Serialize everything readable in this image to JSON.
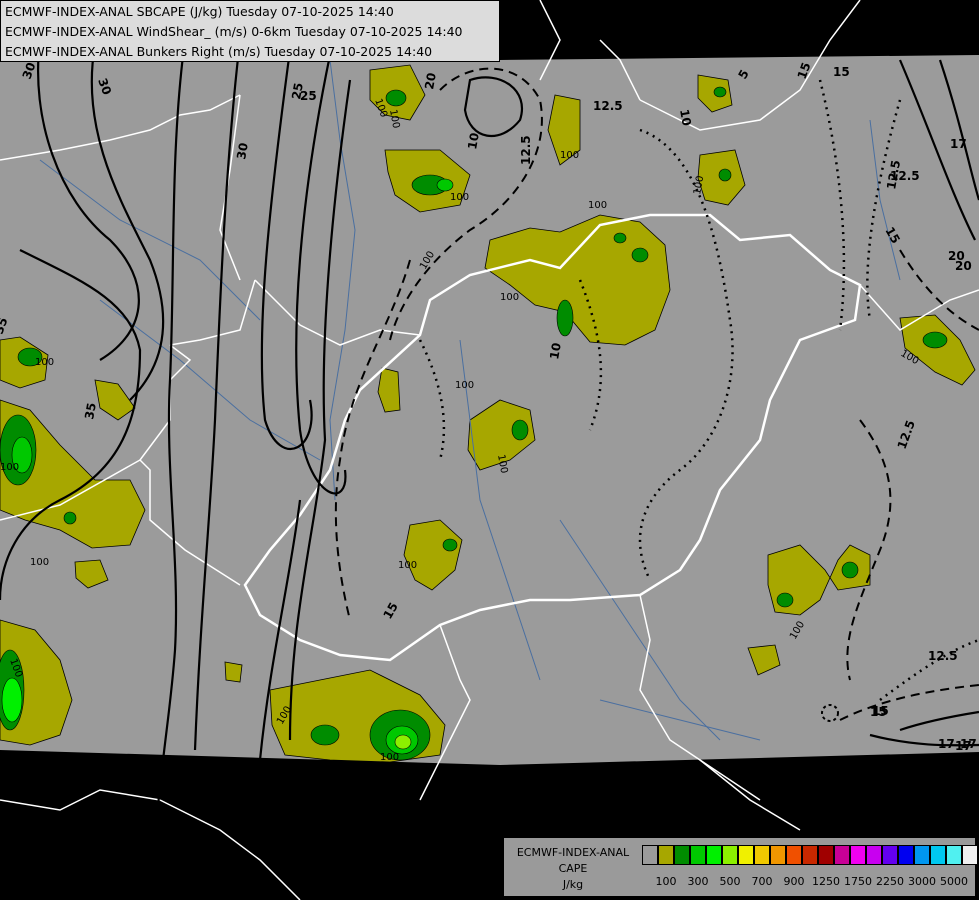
{
  "header": {
    "line1": "ECMWF-INDEX-ANAL SBCAPE (J/kg) Tuesday 07-10-2025 14:40",
    "line2": "ECMWF-INDEX-ANAL WindShear_ (m/s) 0-6km Tuesday 07-10-2025 14:40",
    "line3": "ECMWF-INDEX-ANAL Bunkers Right (m/s) Tuesday 07-10-2025 14:40"
  },
  "legend": {
    "name_line1": "ECMWF-INDEX-ANAL",
    "name_line2": "CAPE",
    "unit": "J/kg",
    "colors": [
      "#9b9b9b",
      "#a7a700",
      "#008c00",
      "#00c800",
      "#00f000",
      "#8cf000",
      "#f0f000",
      "#f0c800",
      "#f09600",
      "#f05000",
      "#c82800",
      "#a00000",
      "#c80096",
      "#f000f0",
      "#c800f0",
      "#6400f0",
      "#0000f0",
      "#0096f0",
      "#00c8f0",
      "#50f0f0",
      "#f0f0f0"
    ],
    "ticks": [
      "100",
      "300",
      "500",
      "700",
      "900",
      "1250",
      "1750",
      "2250",
      "3000",
      "5000"
    ]
  },
  "map": {
    "background_color": "#000000",
    "field_color": "#9b9b9b",
    "border_color": "#ffffff",
    "river_color": "#4a6fa0",
    "contour_color": "#000000",
    "cape_labels": [
      "100",
      "100",
      "100",
      "100",
      "100",
      "100",
      "100",
      "100",
      "100",
      "100",
      "100",
      "100",
      "100",
      "100",
      "100",
      "100",
      "100",
      "100",
      "100"
    ],
    "shear_labels": [
      "30",
      "30",
      "30",
      "25",
      "35",
      "35",
      "20",
      "15",
      "10",
      "10",
      "12.5",
      "12.5",
      "17",
      "20",
      "12.5",
      "15",
      "15",
      "17",
      "12.5",
      "15",
      "5",
      "15",
      "17",
      "20",
      "12.5",
      "10",
      "15",
      "17",
      "25",
      "12.5"
    ]
  }
}
